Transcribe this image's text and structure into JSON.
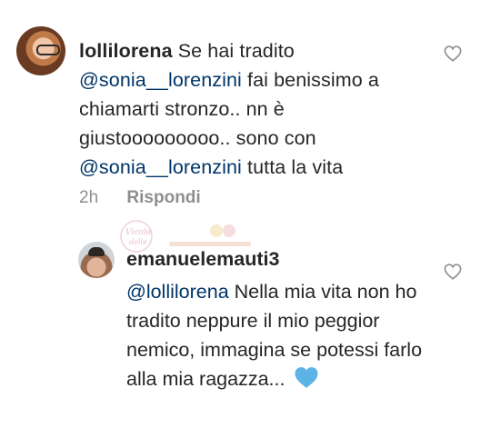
{
  "comment": {
    "username": "lollilorena",
    "text_part1": "Se hai tradito",
    "mention1": "@sonia__lorenzini",
    "text_part2": "fai benissimo a chiamarti stronzo.. nn è giustooooooooo.. sono con",
    "mention2": "@sonia__lorenzini",
    "text_part3": "tutta la vita",
    "time": "2h",
    "reply_label": "Rispondi",
    "like_icon": "heart-outline-icon"
  },
  "reply": {
    "username": "emanuelemauti3",
    "mention": "@lollilorena",
    "text": "Nella mia vita non ho tradito neppure il mio peggior nemico, immagina se potessi farlo alla mia ragazza...",
    "emoji": "blue-heart-icon",
    "like_icon": "heart-outline-icon"
  },
  "colors": {
    "text": "#262626",
    "mention": "#003569",
    "meta": "#8e8e8e",
    "heart_emoji": "#5cb3e6"
  }
}
